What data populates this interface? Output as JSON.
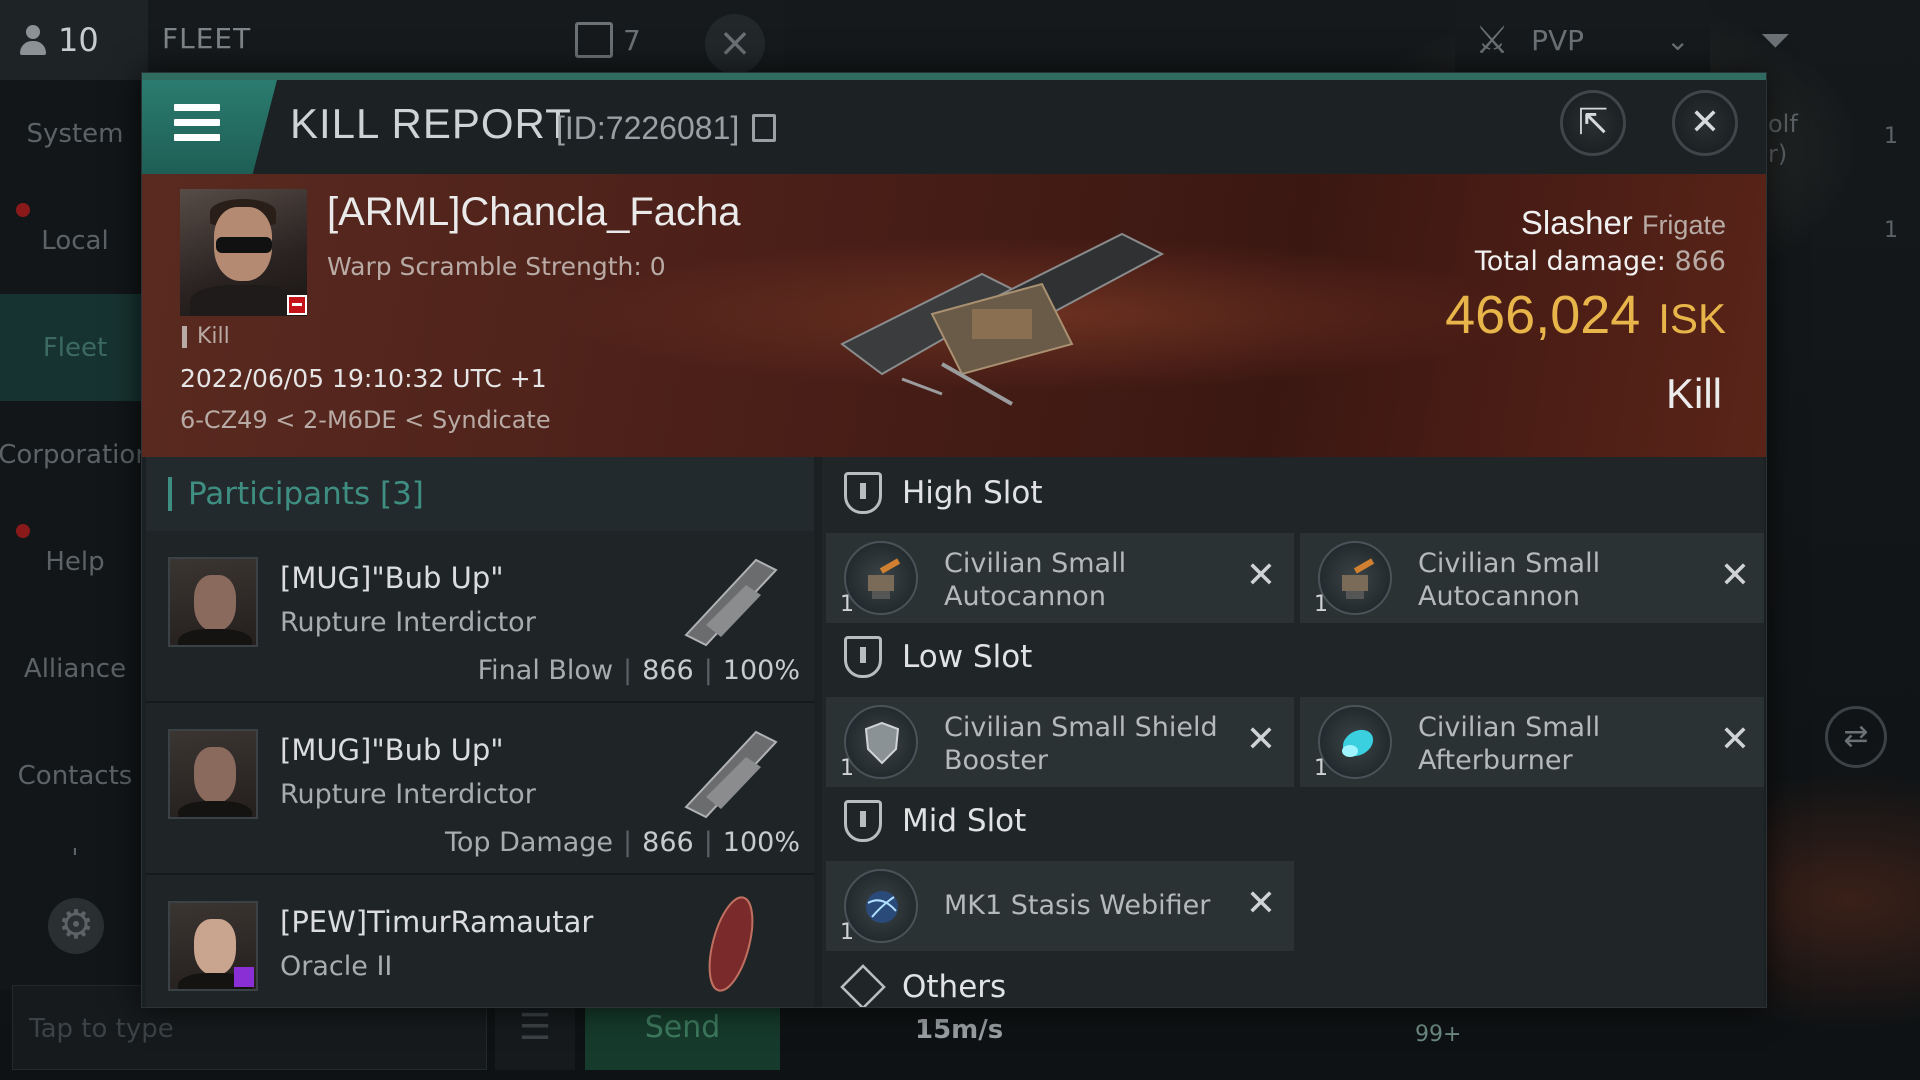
{
  "background": {
    "player_count": "10",
    "fleet_label": "FLEET",
    "fleet_count": "7",
    "pvp_label": "PVP",
    "sidebar": [
      "System",
      "Local",
      "Fleet",
      "Corporation",
      "Help",
      "Alliance",
      "Contacts",
      "'"
    ],
    "chat_placeholder": "Tap to type",
    "send_label": "Send",
    "speed": "15m/s",
    "badge": "99+",
    "right_edge_texts": [
      "olf",
      "r)",
      "1",
      "1"
    ]
  },
  "modal": {
    "title": "KILL REPORT",
    "id_text": "[ID:7226081]"
  },
  "victim": {
    "name": "[ARML]Chancla_Facha",
    "warp_scramble": "Warp Scramble Strength: 0",
    "tag": "Kill",
    "datetime": "2022/06/05 19:10:32 UTC +1",
    "location": "6-CZ49 < 2-M6DE < Syndicate",
    "ship": "Slasher",
    "ship_class": "Frigate",
    "total_damage_label": "Total damage:",
    "total_damage": "866",
    "isk_value": "466,024",
    "isk_unit": "ISK",
    "result": "Kill"
  },
  "participants": {
    "label": "Participants",
    "count": "[3]",
    "list": [
      {
        "name": "[MUG]\"Bub Up\"",
        "ship": "Rupture Interdictor",
        "role": "Final Blow",
        "damage": "866",
        "percent": "100%"
      },
      {
        "name": "[MUG]\"Bub Up\"",
        "ship": "Rupture Interdictor",
        "role": "Top Damage",
        "damage": "866",
        "percent": "100%"
      },
      {
        "name": "[PEW]TimurRamautar",
        "ship": "Oracle II"
      }
    ]
  },
  "fitting": {
    "high_slot": {
      "label": "High Slot",
      "modules": [
        {
          "name": "Civilian Small Autocannon",
          "qty": "1"
        },
        {
          "name": "Civilian Small Autocannon",
          "qty": "1"
        }
      ]
    },
    "low_slot": {
      "label": "Low Slot",
      "modules": [
        {
          "name": "Civilian Small Shield Booster",
          "qty": "1"
        },
        {
          "name": "Civilian Small Afterburner",
          "qty": "1"
        }
      ]
    },
    "mid_slot": {
      "label": "Mid Slot",
      "modules": [
        {
          "name": "MK1 Stasis Webifier",
          "qty": "1"
        }
      ]
    },
    "others": {
      "label": "Others"
    }
  },
  "colors": {
    "accent_teal": "#2f6b61",
    "isk_gold": "#e8b54a",
    "banner_red": "#4a1f18"
  },
  "icons": [
    "menu-icon",
    "copy-icon",
    "share-icon",
    "close-icon",
    "shield-slot-icon",
    "cube-icon",
    "remove-x-icon"
  ]
}
